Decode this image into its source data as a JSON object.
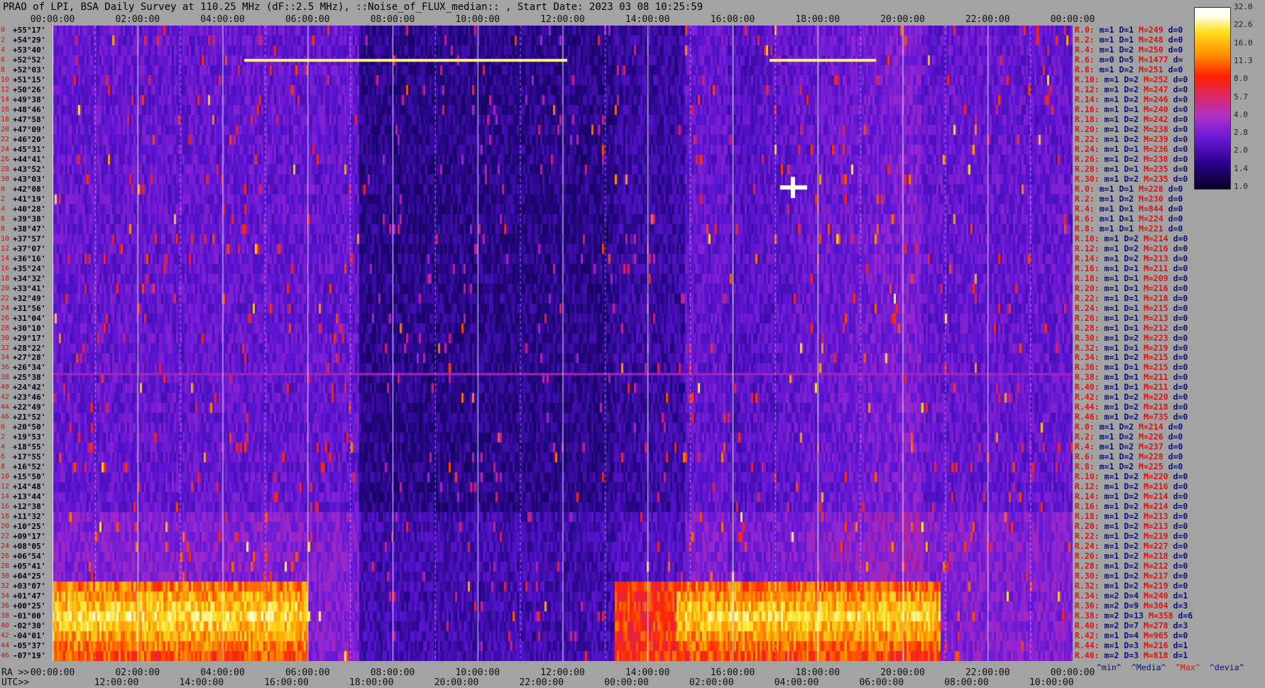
{
  "title": "PRAO of LPI, BSA Daily Survey at 110.25 MHz (dF::2.5 MHz), ::Noise_of_FLUX_median:: , Start Date: 2023 03 08 10:25:59",
  "chart_data": {
    "type": "heatmap",
    "title": "PRAO of LPI, BSA Daily Survey at 110.25 MHz (dF::2.5 MHz), ::Noise_of_FLUX_median:: , Start Date: 2023 03 08 10:25:59",
    "x_top_ticks": [
      "00:00:00",
      "02:00:00",
      "04:00:00",
      "06:00:00",
      "08:00:00",
      "10:00:00",
      "12:00:00",
      "14:00:00",
      "16:00:00",
      "18:00:00",
      "20:00:00",
      "22:00:00",
      "00:00:00"
    ],
    "ra_ticks": [
      "00:00:00",
      "02:00:00",
      "04:00:00",
      "06:00:00",
      "08:00:00",
      "10:00:00",
      "12:00:00",
      "14:00:00",
      "16:00:00",
      "18:00:00",
      "20:00:00",
      "22:00:00",
      "00:00:00"
    ],
    "utc_ticks": [
      "12:00:00",
      "14:00:00",
      "16:00:00",
      "18:00:00",
      "20:00:00",
      "22:00:00",
      "00:00:00",
      "02:00:00",
      "04:00:00",
      "06:00:00",
      "08:00:00",
      "10:00:00"
    ],
    "ra_label": "RA >>",
    "utc_label": "UTC>>",
    "declinations": [
      "+55°17'",
      "+54°29'",
      "+53°40'",
      "+52°52'",
      "+52°03'",
      "+51°15'",
      "+50°26'",
      "+49°38'",
      "+48°46'",
      "+47°58'",
      "+47°09'",
      "+46°20'",
      "+45°31'",
      "+44°41'",
      "+43°52'",
      "+43°03'",
      "+42°08'",
      "+41°19'",
      "+40°28'",
      "+39°38'",
      "+38°47'",
      "+37°57'",
      "+37°07'",
      "+36°16'",
      "+35°24'",
      "+34°32'",
      "+33°41'",
      "+32°49'",
      "+31°56'",
      "+31°04'",
      "+30°10'",
      "+29°17'",
      "+28°22'",
      "+27°28'",
      "+26°34'",
      "+25°38'",
      "+24°42'",
      "+23°46'",
      "+22°49'",
      "+21°52'",
      "+20°50'",
      "+19°53'",
      "+18°55'",
      "+17°55'",
      "+16°52'",
      "+15°50'",
      "+14°48'",
      "+13°44'",
      "+12°38'",
      "+11°32'",
      "+10°25'",
      "+09°17'",
      "+08°05'",
      "+06°54'",
      "+05°41'",
      "+04°25'",
      "+03°07'",
      "+01°47'",
      "+00°25'",
      "-01°00'",
      "-02°30'",
      "-04°01'",
      "-05°37'",
      "-07°19'"
    ],
    "row_indices": [
      "0",
      "2",
      "4",
      "6",
      "8",
      "10",
      "12",
      "14",
      "16",
      "18",
      "20",
      "22",
      "24",
      "26",
      "28",
      "30",
      "0",
      "2",
      "4",
      "6",
      "8",
      "10",
      "12",
      "14",
      "16",
      "18",
      "20",
      "22",
      "24",
      "26",
      "28",
      "30",
      "32",
      "34",
      "36",
      "38",
      "40",
      "42",
      "44",
      "46",
      "0",
      "2",
      "4",
      "6",
      "8",
      "10",
      "12",
      "14",
      "16",
      "18",
      "20",
      "22",
      "24",
      "26",
      "28",
      "30",
      "32",
      "34",
      "36",
      "38",
      "40",
      "42",
      "44",
      "46"
    ],
    "colorbar": {
      "ticks": [
        "32.0",
        "22.6",
        "16.0",
        "11.3",
        "8.0",
        "5.7",
        "4.0",
        "2.8",
        "2.0",
        "1.4",
        "1.0"
      ],
      "scale": "log"
    },
    "stats": [
      [
        "R.0:",
        "1",
        "1",
        "249",
        "0"
      ],
      [
        "R.2:",
        "1",
        "1",
        "248",
        "0"
      ],
      [
        "R.4:",
        "1",
        "2",
        "250",
        "0"
      ],
      [
        "R.6:",
        "0",
        "5",
        "1477",
        ""
      ],
      [
        "R.8:",
        "1",
        "2",
        "251",
        "0"
      ],
      [
        "R.10:",
        "1",
        "2",
        "252",
        "0"
      ],
      [
        "R.12:",
        "1",
        "2",
        "247",
        "0"
      ],
      [
        "R.14:",
        "1",
        "2",
        "246",
        "0"
      ],
      [
        "R.16:",
        "1",
        "1",
        "240",
        "0"
      ],
      [
        "R.18:",
        "1",
        "2",
        "242",
        "0"
      ],
      [
        "R.20:",
        "1",
        "2",
        "238",
        "0"
      ],
      [
        "R.22:",
        "1",
        "2",
        "239",
        "0"
      ],
      [
        "R.24:",
        "1",
        "1",
        "236",
        "0"
      ],
      [
        "R.26:",
        "1",
        "2",
        "238",
        "0"
      ],
      [
        "R.28:",
        "1",
        "1",
        "235",
        "0"
      ],
      [
        "R.30:",
        "1",
        "2",
        "235",
        "0"
      ],
      [
        "R.0:",
        "1",
        "1",
        "228",
        "0"
      ],
      [
        "R.2:",
        "1",
        "2",
        "230",
        "0"
      ],
      [
        "R.4:",
        "1",
        "1",
        "844",
        "0"
      ],
      [
        "R.6:",
        "1",
        "1",
        "224",
        "0"
      ],
      [
        "R.8:",
        "1",
        "1",
        "221",
        "0"
      ],
      [
        "R.10:",
        "1",
        "2",
        "214",
        "0"
      ],
      [
        "R.12:",
        "1",
        "2",
        "216",
        "0"
      ],
      [
        "R.14:",
        "1",
        "2",
        "213",
        "0"
      ],
      [
        "R.16:",
        "1",
        "1",
        "211",
        "0"
      ],
      [
        "R.18:",
        "1",
        "1",
        "209",
        "0"
      ],
      [
        "R.20:",
        "1",
        "1",
        "216",
        "0"
      ],
      [
        "R.22:",
        "1",
        "1",
        "218",
        "0"
      ],
      [
        "R.24:",
        "1",
        "1",
        "215",
        "0"
      ],
      [
        "R.26:",
        "1",
        "1",
        "213",
        "0"
      ],
      [
        "R.28:",
        "1",
        "1",
        "212",
        "0"
      ],
      [
        "R.30:",
        "1",
        "2",
        "223",
        "0"
      ],
      [
        "R.32:",
        "1",
        "1",
        "219",
        "0"
      ],
      [
        "R.34:",
        "1",
        "2",
        "215",
        "0"
      ],
      [
        "R.36:",
        "1",
        "1",
        "215",
        "0"
      ],
      [
        "R.38:",
        "1",
        "1",
        "211",
        "0"
      ],
      [
        "R.40:",
        "1",
        "1",
        "211",
        "0"
      ],
      [
        "R.42:",
        "1",
        "2",
        "220",
        "0"
      ],
      [
        "R.44:",
        "1",
        "2",
        "218",
        "0"
      ],
      [
        "R.46:",
        "1",
        "2",
        "735",
        "0"
      ],
      [
        "R.0:",
        "1",
        "2",
        "214",
        "0"
      ],
      [
        "R.2:",
        "1",
        "2",
        "226",
        "0"
      ],
      [
        "R.4:",
        "1",
        "2",
        "237",
        "0"
      ],
      [
        "R.6:",
        "1",
        "2",
        "228",
        "0"
      ],
      [
        "R.8:",
        "1",
        "2",
        "225",
        "0"
      ],
      [
        "R.10:",
        "1",
        "2",
        "220",
        "0"
      ],
      [
        "R.12:",
        "1",
        "2",
        "216",
        "0"
      ],
      [
        "R.14:",
        "1",
        "2",
        "214",
        "0"
      ],
      [
        "R.16:",
        "1",
        "2",
        "214",
        "0"
      ],
      [
        "R.18:",
        "1",
        "2",
        "213",
        "0"
      ],
      [
        "R.20:",
        "1",
        "2",
        "213",
        "0"
      ],
      [
        "R.22:",
        "1",
        "2",
        "219",
        "0"
      ],
      [
        "R.24:",
        "1",
        "2",
        "227",
        "0"
      ],
      [
        "R.26:",
        "1",
        "2",
        "218",
        "0"
      ],
      [
        "R.28:",
        "1",
        "2",
        "212",
        "0"
      ],
      [
        "R.30:",
        "1",
        "2",
        "217",
        "0"
      ],
      [
        "R.32:",
        "1",
        "2",
        "219",
        "0"
      ],
      [
        "R.34:",
        "2",
        "4",
        "240",
        "1"
      ],
      [
        "R.36:",
        "2",
        "9",
        "304",
        "3"
      ],
      [
        "R.38:",
        "2",
        "13",
        "358",
        "6"
      ],
      [
        "R.40:",
        "2",
        "7",
        "278",
        "3"
      ],
      [
        "R.42:",
        "1",
        "4",
        "965",
        "0"
      ],
      [
        "R.44:",
        "1",
        "3",
        "216",
        "1"
      ],
      [
        "R.46:",
        "2",
        "3",
        "818",
        "1"
      ]
    ],
    "stat_keys": {
      "m": "m=",
      "D": "D=",
      "M": "M=",
      "d": "d="
    },
    "legend": {
      "min": "^min^",
      "median": "^Media^",
      "max": "^Max^",
      "devia": "^devia^"
    },
    "colors": {
      "background": "#a3a3a3",
      "label_red": "#e01010",
      "label_blue": "#0a1078"
    }
  }
}
